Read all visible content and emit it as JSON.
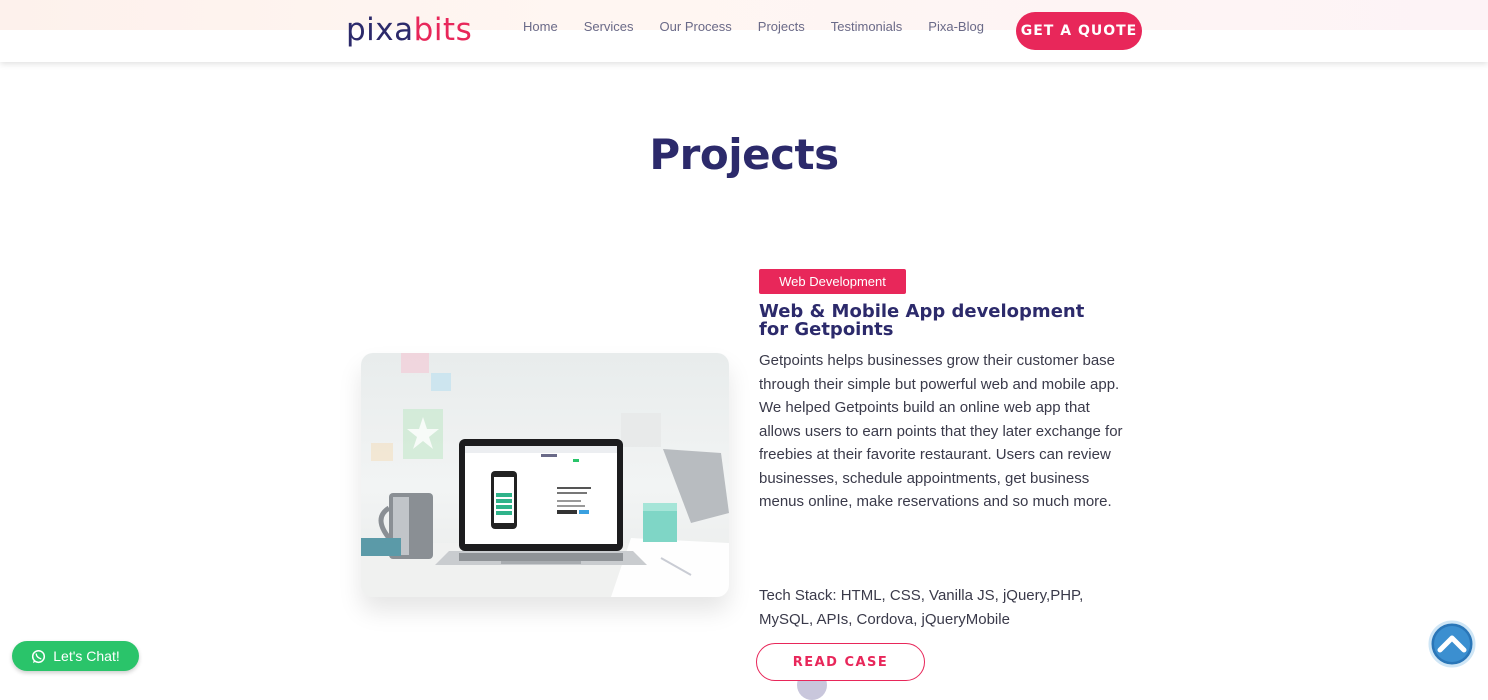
{
  "header": {
    "logo_part1": "pixa",
    "logo_part2": "bits",
    "nav": [
      "Home",
      "Services",
      "Our Process",
      "Projects",
      "Testimonials",
      "Pixa-Blog"
    ],
    "quote_button": "GET A QUOTE"
  },
  "page": {
    "title": "Projects"
  },
  "project": {
    "tag": "Web Development",
    "title": "Web & Mobile App development for Getpoints",
    "description": "Getpoints helps businesses grow their customer base through their simple but powerful web and mobile app. We helped Getpoints build an online web app that allows users to earn points that they later exchange for freebies at their favorite restaurant. Users can review businesses, schedule appointments, get business menus online, make reservations and so much more.",
    "tech_stack": "Tech Stack:  HTML, CSS, Vanilla JS, jQuery,PHP, MySQL,  APIs, Cordova, jQueryMobile",
    "read_button": "READ CASE",
    "image_icon": "laptop-mockup-image"
  },
  "widgets": {
    "chat_label": "Let's Chat!",
    "chat_icon": "whatsapp-icon",
    "scroll_icon": "scroll-to-top-icon"
  },
  "colors": {
    "brand_navy": "#2c2a6b",
    "brand_pink": "#e8275a",
    "chat_green": "#2ac46a",
    "scroll_blue": "#2a76b8"
  }
}
